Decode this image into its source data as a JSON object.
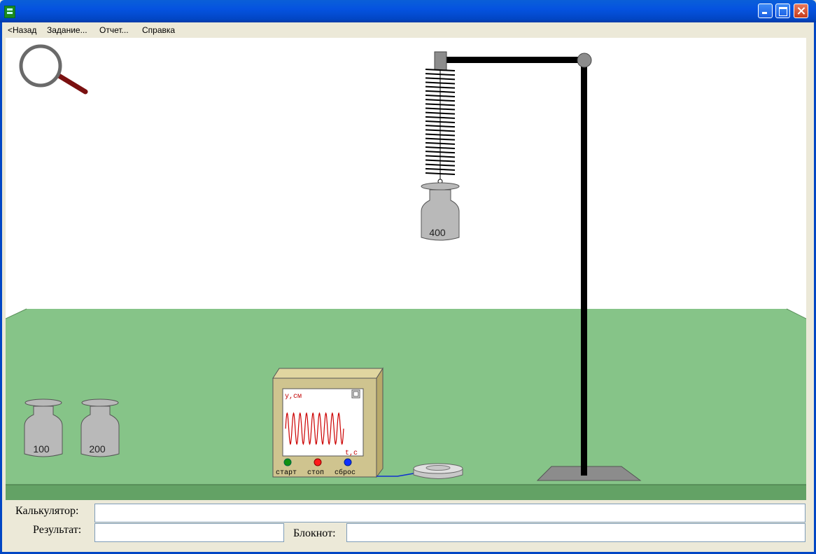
{
  "window": {
    "title": ""
  },
  "menu": {
    "back": "<Назад",
    "task": "Задание...",
    "report": "Отчет...",
    "help": "Справка"
  },
  "weights": {
    "hanging": "400",
    "table": [
      "100",
      "200"
    ]
  },
  "instrument": {
    "y_label": "y,см",
    "t_label": "t,с",
    "start": "старт",
    "stop": "стоп",
    "reset": "сброс",
    "colors": {
      "start": "#109010",
      "stop": "#ff1a1a",
      "reset": "#1030ff",
      "trace": "#cc0000"
    }
  },
  "bottom": {
    "calculator_label": "Калькулятор:",
    "result_label": "Результат:",
    "notebook_label": "Блокнот:",
    "calculator_value": "",
    "result_value": "",
    "notebook_value": ""
  }
}
